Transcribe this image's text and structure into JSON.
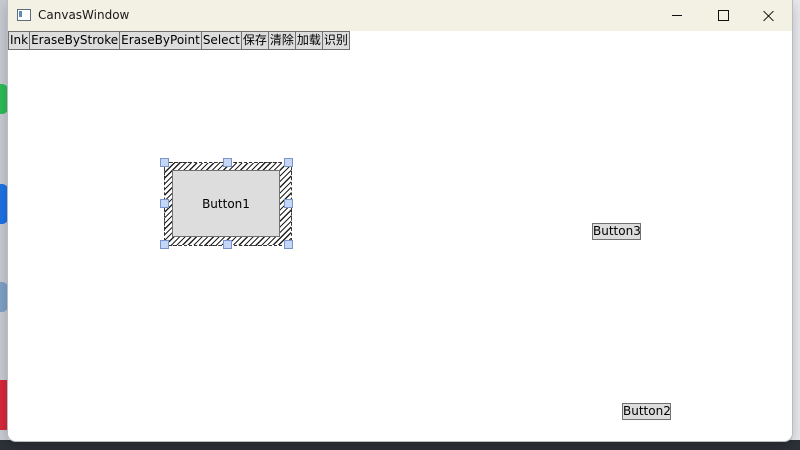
{
  "window": {
    "title": "CanvasWindow"
  },
  "toolbar": {
    "buttons": [
      "Ink",
      "EraseByStroke",
      "EraseByPoint",
      "Select",
      "保存",
      "清除",
      "加载",
      "识别"
    ]
  },
  "canvas": {
    "button1_label": "Button1",
    "button2_label": "Button2",
    "button3_label": "Button3"
  },
  "icons": {
    "app": "window-icon",
    "minimize": "minimize-icon",
    "maximize": "maximize-icon",
    "close": "close-icon"
  },
  "colors": {
    "titlebar": "#f3f0e4",
    "button_face": "#dddddd",
    "button_border": "#707070",
    "selection_handle": "#c6d6f7"
  }
}
